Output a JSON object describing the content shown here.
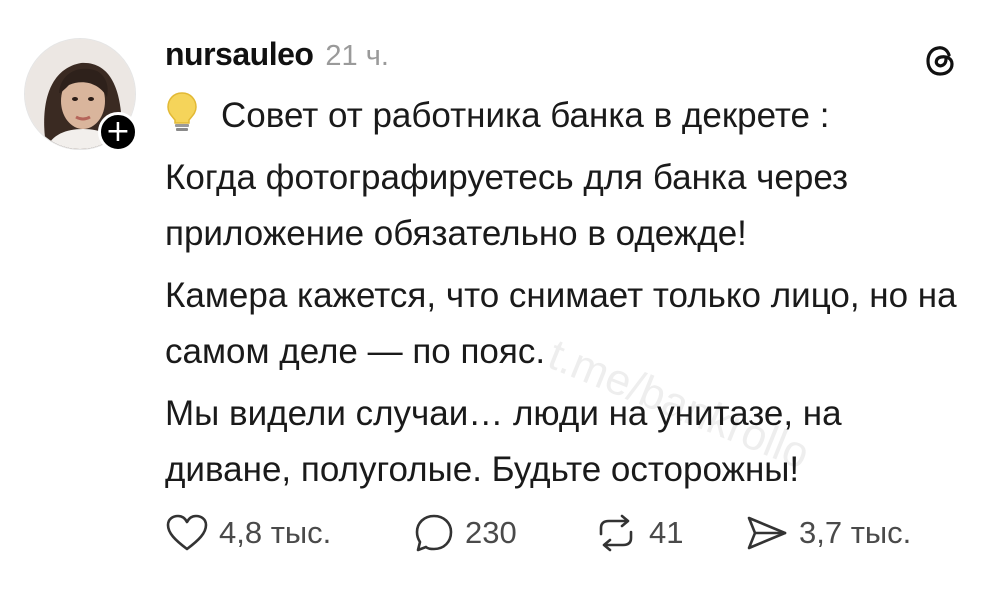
{
  "post": {
    "username": "nursauleo",
    "time_ago": "21 ч.",
    "paragraphs": [
      "Совет от работника банка в декрете :",
      "Когда фотографируетесь для банка через приложение обязательно в одежде!",
      "Камера кажется, что снимает только лицо, но на самом деле — по пояс.",
      "Мы видели случаи… люди на унитазе, на диване, полуголые. Будьте осторожны!"
    ],
    "actions": {
      "likes": "4,8 тыс.",
      "comments": "230",
      "reposts": "41",
      "shares": "3,7 тыс."
    },
    "follow_symbol": "+",
    "watermark": "t.me/bankrollo"
  },
  "icons": {
    "avatar": "profile-photo",
    "follow": "plus-icon",
    "logo": "threads-logo-icon",
    "bulb": "light-bulb-emoji-icon",
    "like": "heart-icon",
    "comment": "speech-bubble-icon",
    "repost": "repost-arrows-icon",
    "share": "paper-plane-icon"
  },
  "colors": {
    "text": "#1a1a1a",
    "muted": "#9a9a9a",
    "badge": "#000000",
    "bulb": "#f5c842"
  }
}
